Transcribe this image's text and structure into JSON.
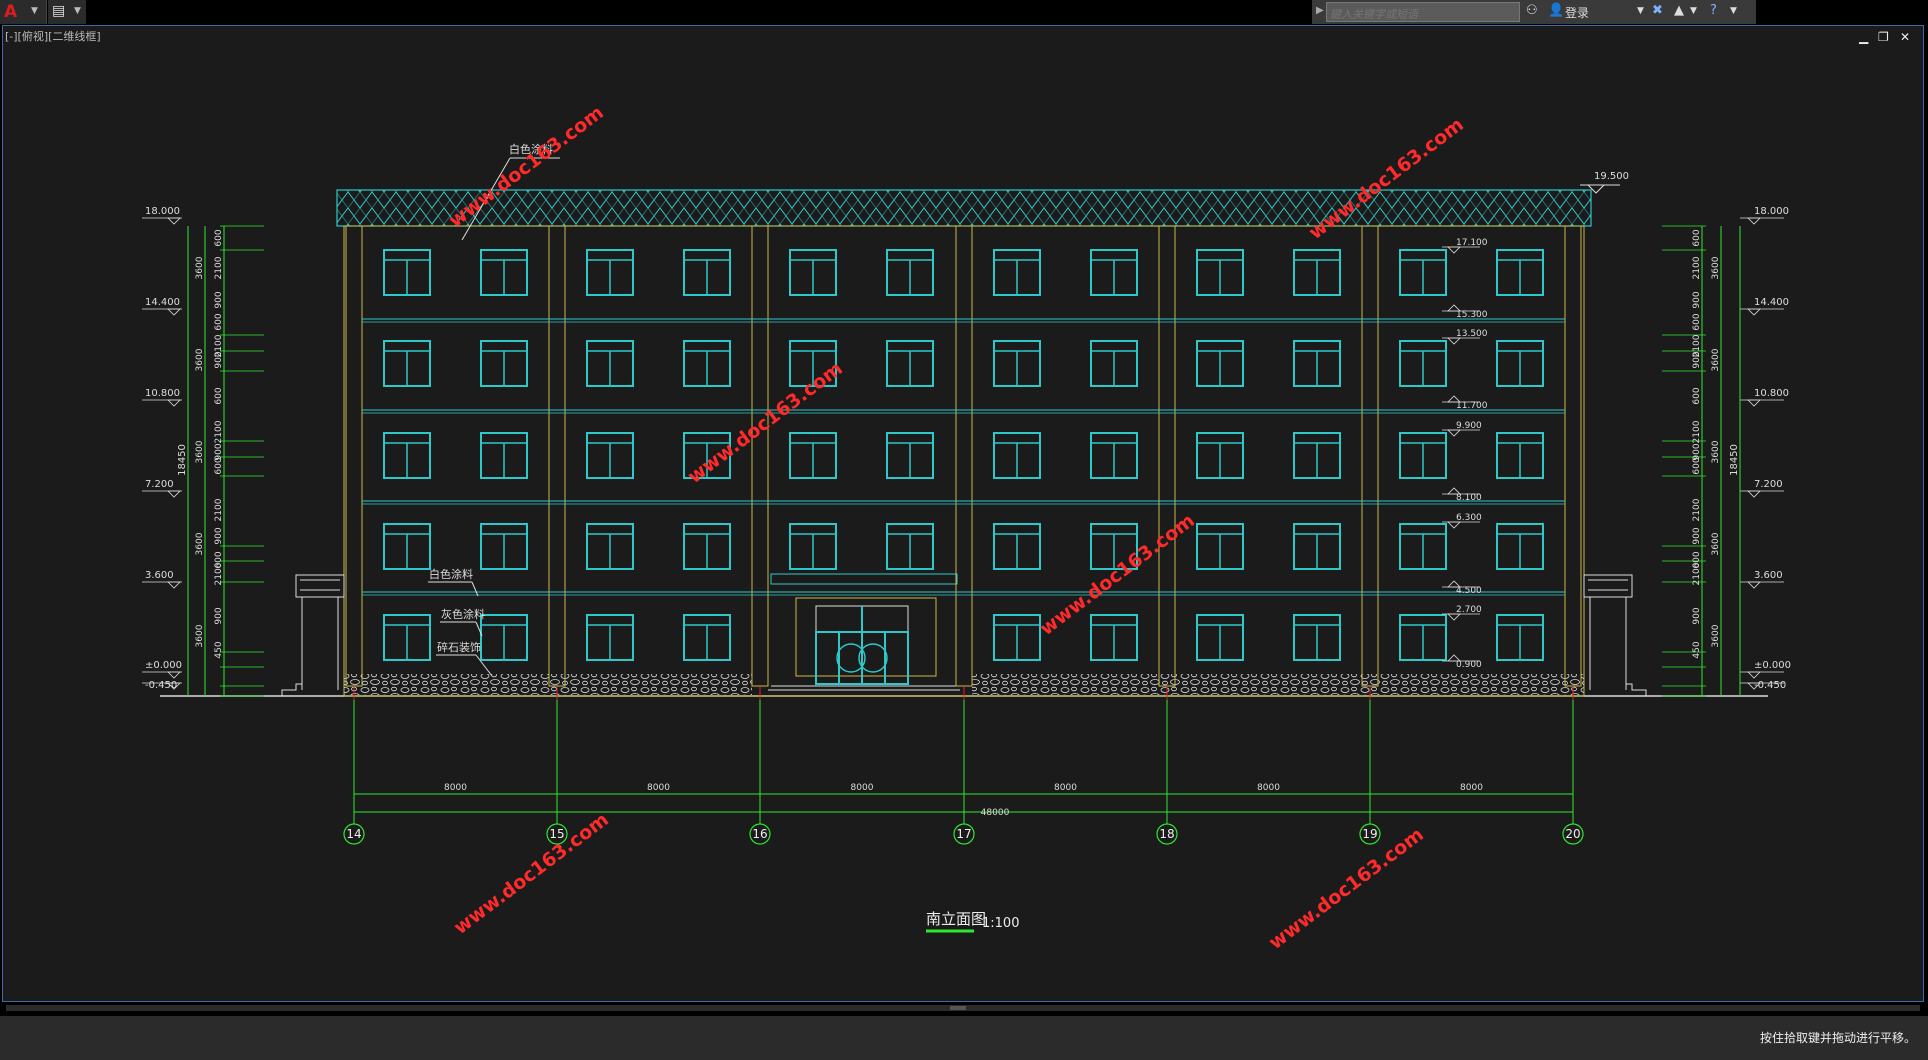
{
  "app": {
    "qa_icon": "save-disk-icon",
    "search_placeholder": "键入关键字或短语",
    "login_label": "登录",
    "viewport_label": "[-][俯视][二维线框]",
    "status_message": "按住拾取键并拖动进行平移。",
    "icons": [
      "application-logo-icon",
      "binoculars-icon",
      "user-icon",
      "exchange-x-icon",
      "a360-icon",
      "help-icon"
    ]
  },
  "drawing": {
    "title": "南立面图",
    "scale": "1:100",
    "annotations": [
      "白色涂料",
      "白色涂料",
      "灰色涂料",
      "碎石装饰"
    ],
    "roof_elevation": "19.500",
    "left_levels": [
      "18.000",
      "14.400",
      "10.800",
      "7.200",
      "3.600",
      "±0.000",
      "-0.450"
    ],
    "right_levels": [
      "18.000",
      "14.400",
      "10.800",
      "7.200",
      "3.600",
      "±0.000",
      "-0.450"
    ],
    "window_levels": [
      "17.100",
      "15.300",
      "13.500",
      "11.700",
      "9.900",
      "8.100",
      "6.300",
      "4.500",
      "2.700",
      "0.900"
    ],
    "total_height": "18450",
    "vertical_dims": [
      "600",
      "2100",
      "900",
      "600",
      "2100",
      "900",
      "600",
      "2100",
      "900",
      "600",
      "2100",
      "900",
      "600",
      "2100",
      "900",
      "450"
    ],
    "floor_dims": [
      "3600",
      "3600",
      "3600",
      "3600",
      "3600"
    ],
    "bay_dims": [
      "8000",
      "8000",
      "8000",
      "8000",
      "8000",
      "8000"
    ],
    "total_width": "48000",
    "axes": [
      "14",
      "15",
      "16",
      "17",
      "18",
      "19",
      "20"
    ],
    "watermarks": [
      "www.doc163.com",
      "www.doc163.com",
      "www.doc163.com",
      "www.doc163.com",
      "www.doc163.com",
      "www.doc163.com"
    ]
  }
}
